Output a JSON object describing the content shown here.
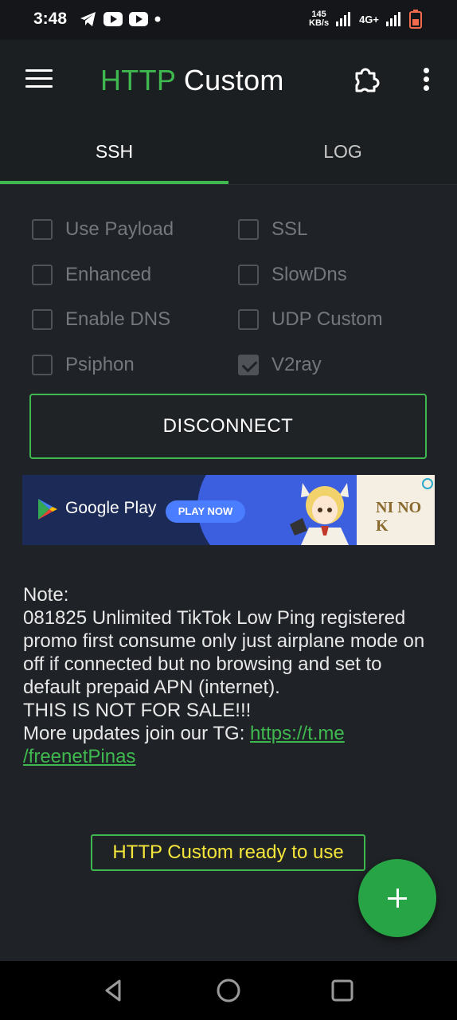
{
  "status_bar": {
    "time": "3:48",
    "speed_value": "145",
    "speed_unit": "KB/s",
    "network": "4G+",
    "icons": [
      "telegram-icon",
      "youtube-icon",
      "youtube-icon",
      "dot-icon",
      "signal-icon",
      "battery-icon"
    ]
  },
  "appbar": {
    "title_http": "HTTP",
    "title_custom": "Custom",
    "accent": "#3fb94f"
  },
  "tabs": [
    {
      "label": "SSH",
      "active": true
    },
    {
      "label": "LOG",
      "active": false
    }
  ],
  "options": [
    {
      "label": "Use Payload",
      "checked": false
    },
    {
      "label": "SSL",
      "checked": false
    },
    {
      "label": "Enhanced",
      "checked": false
    },
    {
      "label": "SlowDns",
      "checked": false
    },
    {
      "label": "Enable DNS",
      "checked": false
    },
    {
      "label": "UDP Custom",
      "checked": false
    },
    {
      "label": "Psiphon",
      "checked": false
    },
    {
      "label": "V2ray",
      "checked": true
    }
  ],
  "disconnect_label": "DISCONNECT",
  "ad": {
    "store_text": "Google Play",
    "cta": "PLAY NOW",
    "brand": "NI NO K"
  },
  "note": {
    "heading": "Note:",
    "body": "081825 Unlimited TikTok Low Ping registered promo first consume only just airplane mode on off if connected but no browsing and set to default prepaid APN (internet).",
    "warning": "THIS IS NOT FOR SALE!!!",
    "updates_prefix": "More updates join our TG: ",
    "link": "https://t.me/freenetPinas",
    "link_line1": "https://t.me",
    "link_line2": "/freenetPinas"
  },
  "status_message": "HTTP Custom ready to use",
  "fab_icon": "plus-icon",
  "nav": [
    "back-icon",
    "home-icon",
    "recents-icon"
  ]
}
